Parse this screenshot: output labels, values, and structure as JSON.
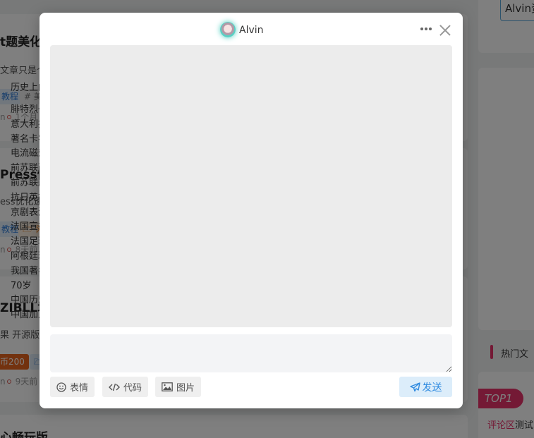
{
  "background": {
    "posts": [
      {
        "title": "t题美化",
        "excerpt": "文章只是个",
        "tags": [
          "教程",
          "# 美"
        ],
        "meta": "1个月"
      },
      {
        "title": "Press优",
        "excerpt": "ess优化速",
        "tags": [
          "教程",
          "🗁 网"
        ],
        "meta": "8天前"
      },
      {
        "title": "ZIBLL增",
        "excerpt": "果 开源版",
        "tags": [
          "币200",
          "🗁"
        ],
        "meta": "9天前"
      },
      {
        "title": "心畅玩版"
      }
    ],
    "meta_prefix": "n",
    "search_value": "Alvin资",
    "history": {
      "title": "历史上的今",
      "items": [
        "腓特烈一世",
        "意大利探险",
        "著名卡农曲",
        "电流磁效应",
        "前苏联政治",
        "前苏联航天",
        "抗日英雄中",
        "京剧表演艺",
        "法国宣布退",
        "法国足球名",
        "阿根廷球星",
        "我国著名植",
        "70岁",
        "中国历史上",
        "中国加入不"
      ]
    },
    "hot": {
      "title": "热门文",
      "badge": "TOP1",
      "sub_highlight": "评论区",
      "sub_text": "测试"
    }
  },
  "modal": {
    "user_name": "Alvin",
    "input_placeholder": "",
    "toolbar": {
      "emoji_label": "表情",
      "code_label": "代码",
      "image_label": "图片",
      "send_label": "发送"
    }
  },
  "colors": {
    "accent": "#2e8ae0",
    "hot": "#e8336b"
  }
}
